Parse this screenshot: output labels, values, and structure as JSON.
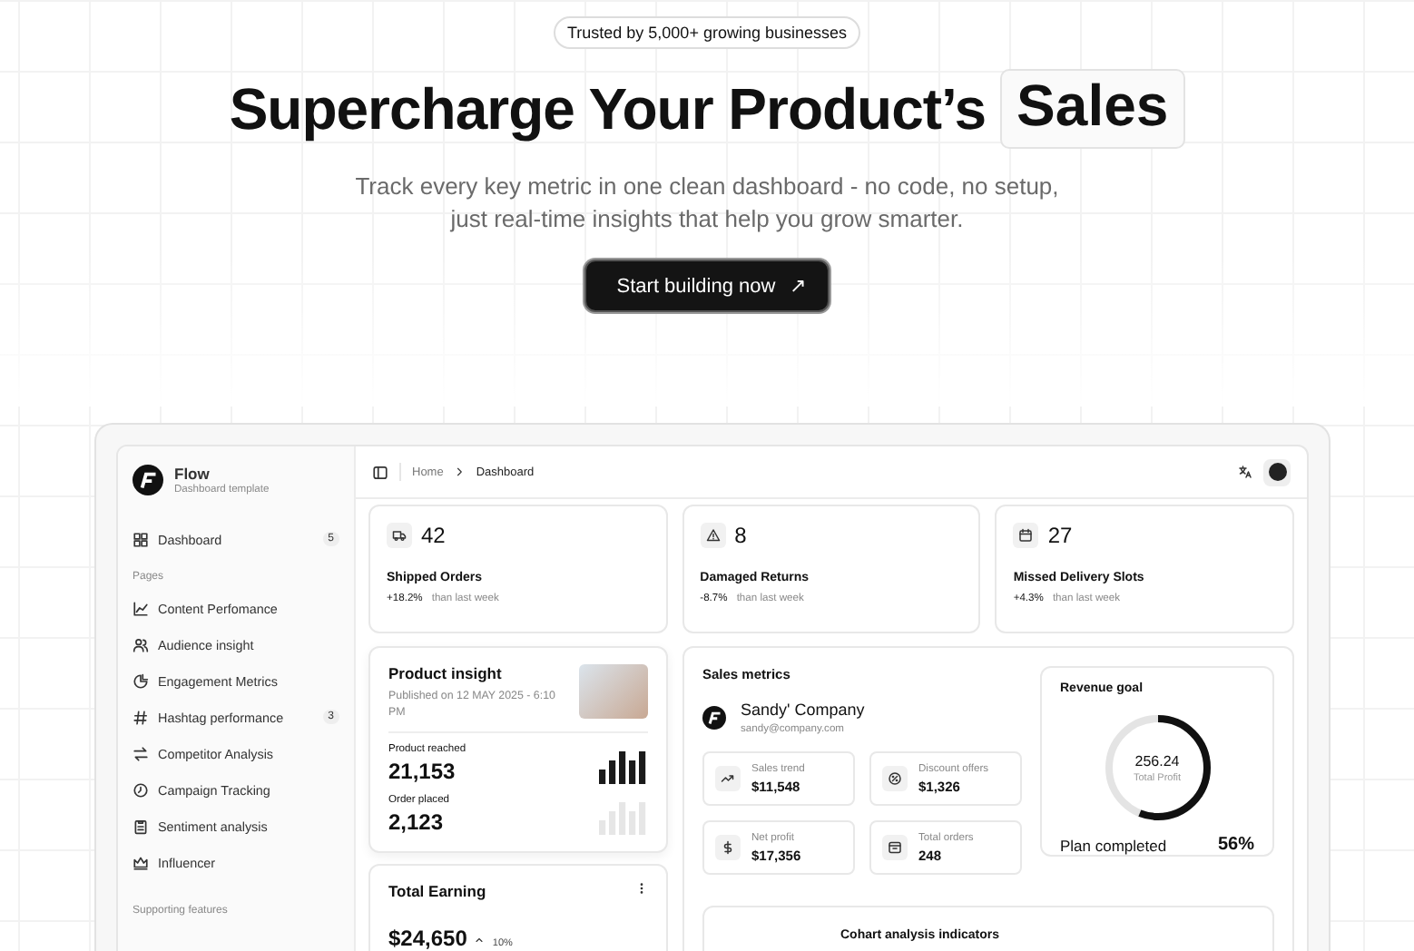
{
  "hero": {
    "badge": "Trusted by 5,000+ growing businesses",
    "title": "Supercharge Your Product’s",
    "title_highlight": "Sales",
    "subtitle_lines": [
      "Track every key metric in one clean dashboard - no code, no setup,",
      "just real-time insights that help you grow smarter."
    ],
    "cta": "Start building now",
    "cta_icon": "↗"
  },
  "sidebar": {
    "brand": "Flow",
    "brand_subtitle": "Dashboard template",
    "top_items": [
      {
        "label": "Dashboard",
        "badge": "5"
      }
    ],
    "section_title": "Pages",
    "items": [
      {
        "label": "Content Perfomance"
      },
      {
        "label": "Audience insight"
      },
      {
        "label": "Engagement Metrics"
      },
      {
        "label": "Hashtag performance",
        "badge": "3"
      },
      {
        "label": "Competitor Analysis"
      },
      {
        "label": "Campaign Tracking"
      },
      {
        "label": "Sentiment analysis"
      },
      {
        "label": "Influencer"
      }
    ],
    "section_title_2": "Supporting features"
  },
  "topbar": {
    "breadcrumb": [
      "Home",
      "Dashboard"
    ]
  },
  "stats": [
    {
      "value": "42",
      "label": "Shipped Orders",
      "change": "+18.2%",
      "note": "than last week"
    },
    {
      "value": "8",
      "label": "Damaged Returns",
      "change": "-8.7%",
      "note": "than last week"
    },
    {
      "value": "27",
      "label": "Missed Delivery Slots",
      "change": "+4.3%",
      "note": "than last week"
    }
  ],
  "product_insight": {
    "title": "Product insight",
    "published": "Published on 12 MAY 2025 - 6:10 PM",
    "metrics": [
      {
        "label": "Product reached",
        "value": "21,153"
      },
      {
        "label": "Order placed",
        "value": "2,123"
      }
    ]
  },
  "total_earning": {
    "title": "Total Earning",
    "value": "$24,650",
    "change": "10%"
  },
  "sales_metrics": {
    "title": "Sales metrics",
    "company": "Sandy' Company",
    "email": "sandy@company.com",
    "tiles": [
      {
        "label": "Sales trend",
        "value": "$11,548"
      },
      {
        "label": "Discount offers",
        "value": "$1,326"
      },
      {
        "label": "Net profit",
        "value": "$17,356"
      },
      {
        "label": "Total orders",
        "value": "248"
      }
    ],
    "revenue_goal": {
      "title": "Revenue goal",
      "value": "256.24",
      "caption": "Total Profit",
      "level": 0.56,
      "footer_label": "Plan completed",
      "footer_value": "56%"
    },
    "cohort_title": "Cohart analysis indicators"
  }
}
